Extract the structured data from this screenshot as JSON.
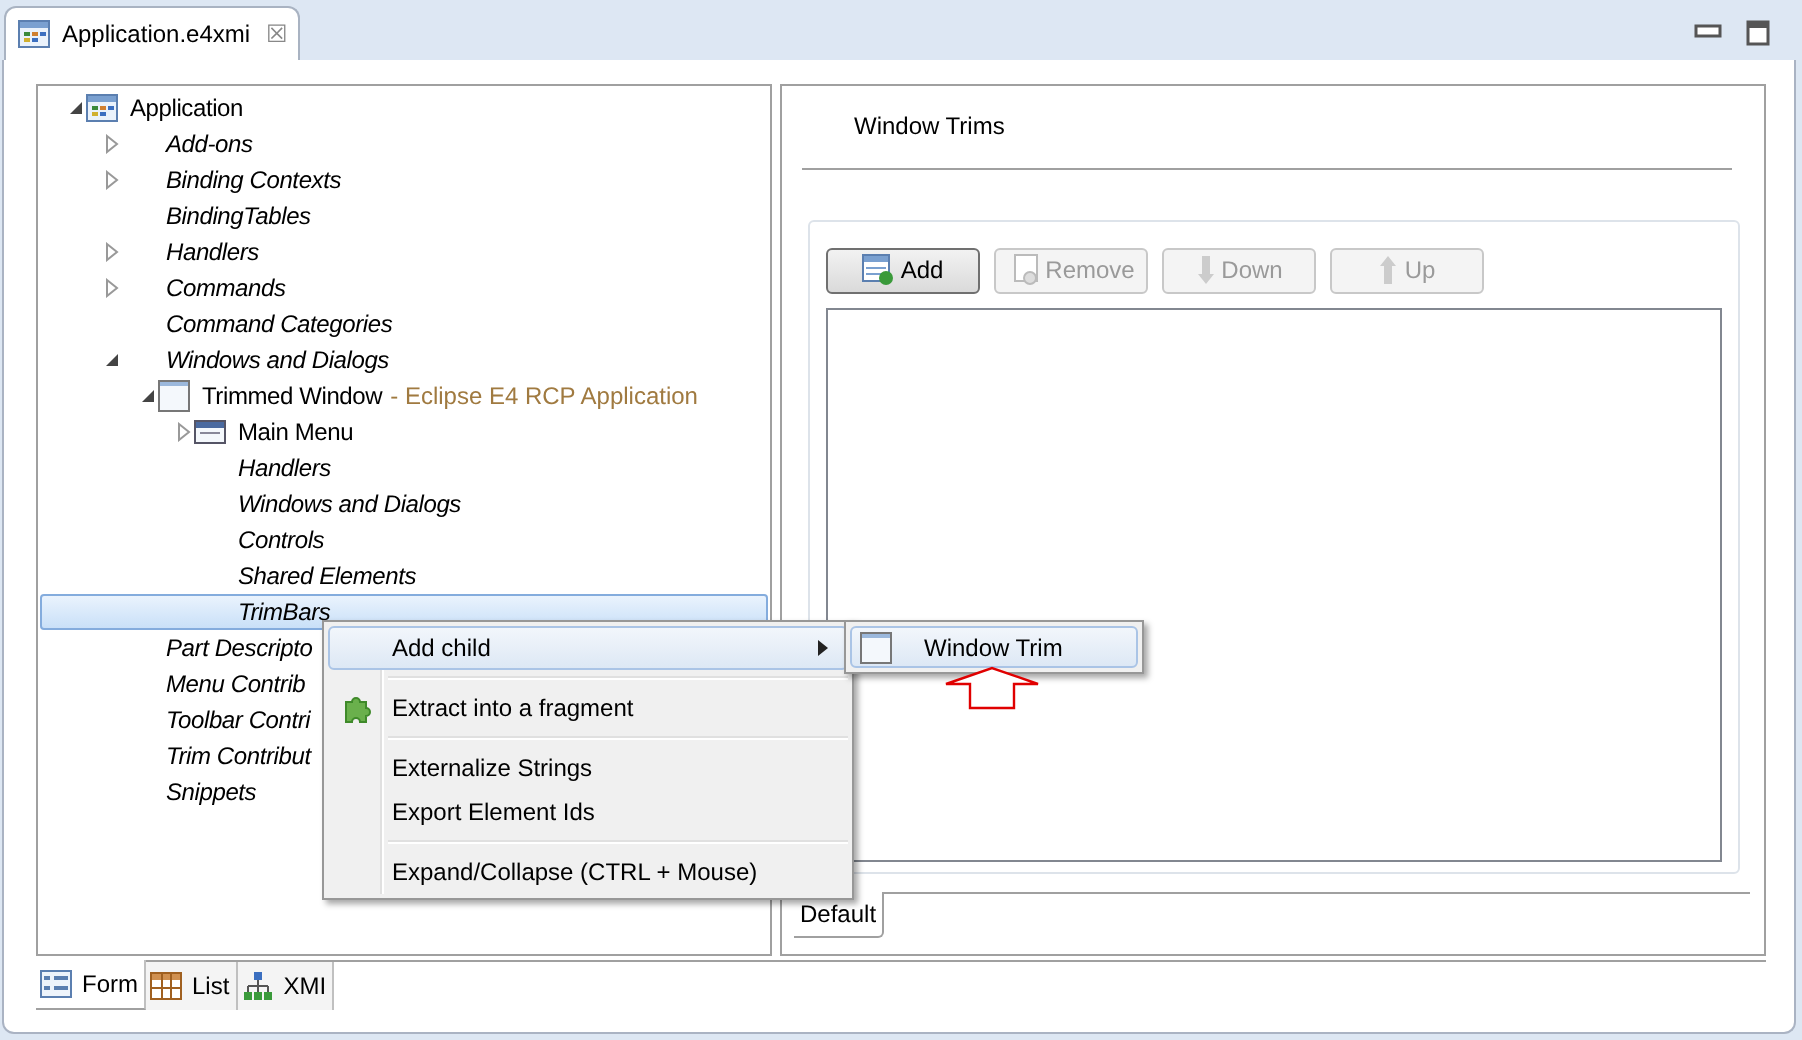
{
  "editor_tab": {
    "title": "Application.e4xmi",
    "close": "☒"
  },
  "tree": [
    {
      "label": "Application",
      "kind": "application",
      "expanded": true,
      "selected": false,
      "children": [
        {
          "label": "Add-ons",
          "kind": "folder",
          "expanded": false,
          "selected": false
        },
        {
          "label": "Binding Contexts",
          "kind": "folder",
          "expanded": false,
          "selected": false
        },
        {
          "label": "BindingTables",
          "kind": "folder",
          "selected": false
        },
        {
          "label": "Handlers",
          "kind": "folder",
          "expanded": false,
          "selected": false
        },
        {
          "label": "Commands",
          "kind": "folder",
          "expanded": false,
          "selected": false
        },
        {
          "label": "Command Categories",
          "kind": "folder",
          "selected": false
        },
        {
          "label": "Windows and Dialogs",
          "kind": "folder",
          "expanded": true,
          "selected": false,
          "children": [
            {
              "label": "Trimmed Window",
              "detail": "- Eclipse E4 RCP Application",
              "kind": "window",
              "expanded": true,
              "selected": false,
              "children": [
                {
                  "label": "Main Menu",
                  "kind": "menu",
                  "expanded": false,
                  "selected": false
                },
                {
                  "label": "Handlers",
                  "kind": "folder",
                  "selected": false
                },
                {
                  "label": "Windows and Dialogs",
                  "kind": "folder",
                  "selected": false
                },
                {
                  "label": "Controls",
                  "kind": "folder",
                  "selected": false
                },
                {
                  "label": "Shared Elements",
                  "kind": "folder",
                  "selected": false
                },
                {
                  "label": "TrimBars",
                  "kind": "folder",
                  "selected": true
                }
              ]
            }
          ]
        },
        {
          "label": "Part Descripto",
          "kind": "folder",
          "selected": false
        },
        {
          "label": "Menu Contrib",
          "kind": "folder",
          "selected": false
        },
        {
          "label": "Toolbar Contri",
          "kind": "folder",
          "selected": false
        },
        {
          "label": "Trim Contribut",
          "kind": "folder",
          "selected": false
        },
        {
          "label": "Snippets",
          "kind": "folder",
          "selected": false
        }
      ]
    }
  ],
  "context_menu": {
    "groups": [
      [
        {
          "label": "Add child",
          "kind": "submenu",
          "selected": true
        }
      ],
      [
        {
          "label": "Extract into a fragment",
          "kind": "puzzle",
          "selected": false
        }
      ],
      [
        {
          "label": "Externalize Strings",
          "kind": "plain",
          "selected": false
        },
        {
          "label": "Export Element Ids",
          "kind": "plain",
          "selected": false
        }
      ],
      [
        {
          "label": "Expand/Collapse (CTRL + Mouse)",
          "kind": "plain",
          "selected": false
        }
      ]
    ]
  },
  "submenu": {
    "items": [
      {
        "label": "Window Trim",
        "selected": true
      }
    ]
  },
  "details": {
    "title": "Window Trims",
    "buttons": [
      {
        "label": "Add",
        "disabled": false
      },
      {
        "label": "Remove",
        "disabled": true
      },
      {
        "label": "Down",
        "disabled": true
      },
      {
        "label": "Up",
        "disabled": true
      }
    ],
    "tabs": [
      {
        "label": "Default",
        "selected": true
      }
    ]
  },
  "bottom_tabs": [
    {
      "label": "Form",
      "selected": true
    },
    {
      "label": "List",
      "selected": false
    },
    {
      "label": "XMI",
      "selected": false
    }
  ]
}
